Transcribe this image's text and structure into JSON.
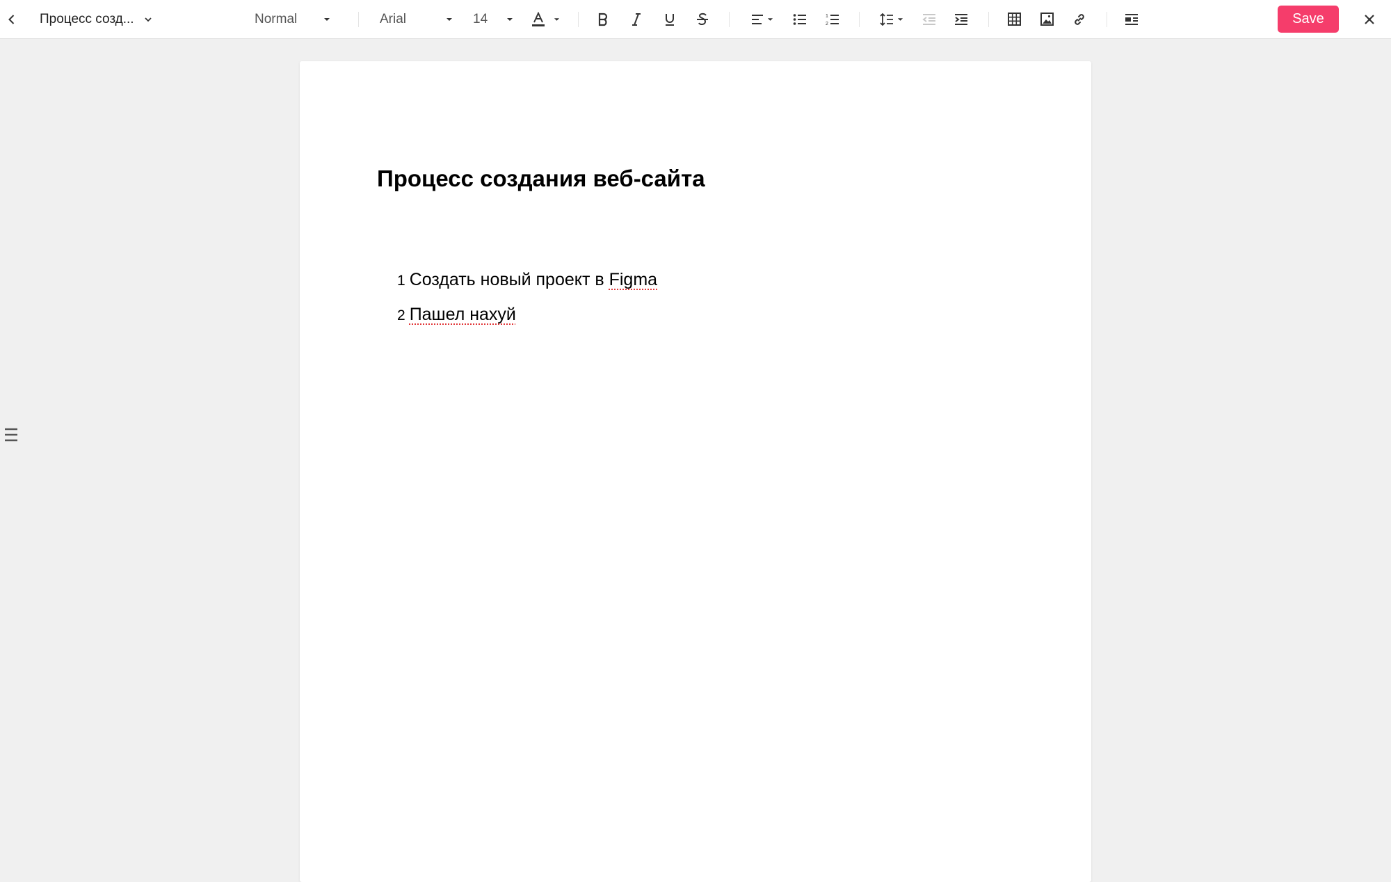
{
  "toolbar": {
    "document_name": "Процесс созд...",
    "paragraph_style": "Normal",
    "font_family": "Arial",
    "font_size": "14",
    "save_label": "Save",
    "accent_color": "#f53d6b",
    "icons": [
      "back-arrow-icon",
      "chevron-down-icon",
      "text-color-icon",
      "bold-icon",
      "italic-icon",
      "underline-icon",
      "strikethrough-icon",
      "align-left-icon",
      "bullet-list-icon",
      "numbered-list-icon",
      "line-spacing-icon",
      "outdent-icon",
      "indent-icon",
      "table-icon",
      "image-icon",
      "link-icon",
      "page-layout-icon",
      "close-icon",
      "menu-icon"
    ]
  },
  "document": {
    "heading": "Процесс создания веб-сайта",
    "items": [
      {
        "number": "1",
        "text": "Создать новый проект в ",
        "flagged": "Figma"
      },
      {
        "number": "2",
        "text": "",
        "flagged": "Пашел нахуй"
      }
    ]
  }
}
